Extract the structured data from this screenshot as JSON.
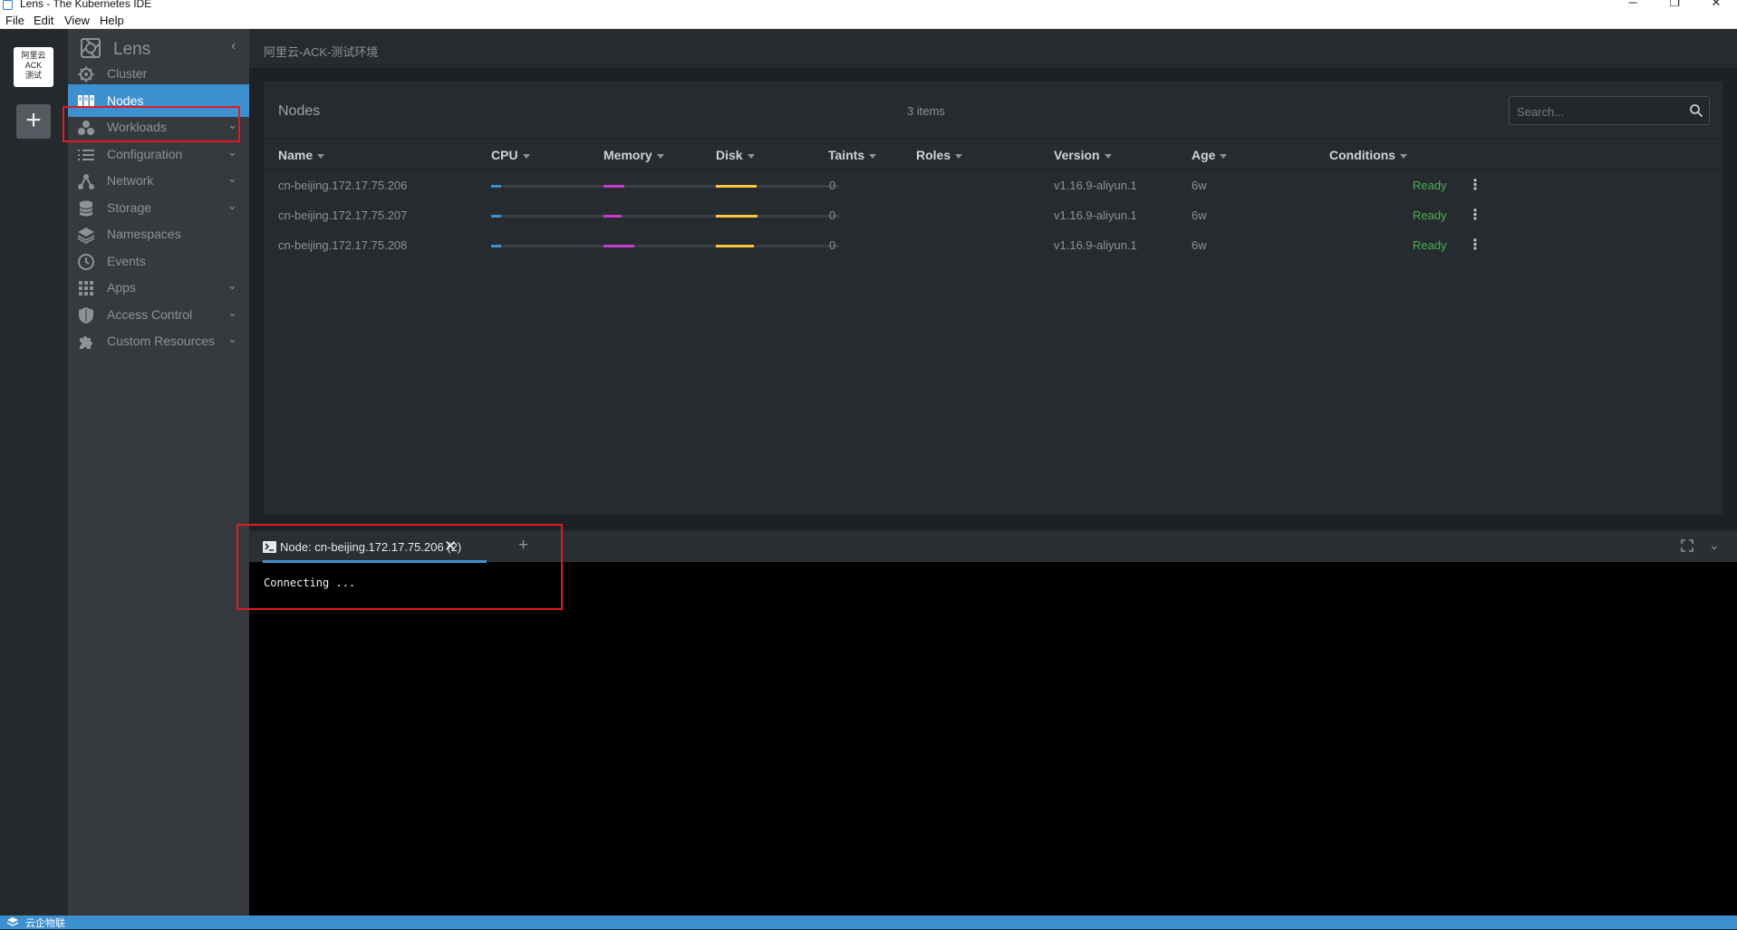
{
  "window": {
    "title": "Lens - The Kubernetes IDE",
    "controls": [
      "─",
      "❐",
      "✕"
    ]
  },
  "menu": [
    "File",
    "Edit",
    "View",
    "Help"
  ],
  "hotbar": {
    "cluster_label_lines": [
      "阿里云",
      "ACK",
      "测试"
    ],
    "add_label": "+"
  },
  "sidebar": {
    "brand": "Lens",
    "items": [
      {
        "label": "Cluster",
        "icon": "helm-wheel-icon",
        "expandable": false
      },
      {
        "label": "Nodes",
        "icon": "nodes-icon",
        "expandable": false,
        "active": true
      },
      {
        "label": "Workloads",
        "icon": "workloads-icon",
        "expandable": true
      },
      {
        "label": "Configuration",
        "icon": "list-icon",
        "expandable": true
      },
      {
        "label": "Network",
        "icon": "network-icon",
        "expandable": true
      },
      {
        "label": "Storage",
        "icon": "database-icon",
        "expandable": true
      },
      {
        "label": "Namespaces",
        "icon": "layers-icon",
        "expandable": false
      },
      {
        "label": "Events",
        "icon": "clock-icon",
        "expandable": false
      },
      {
        "label": "Apps",
        "icon": "apps-grid-icon",
        "expandable": true
      },
      {
        "label": "Access Control",
        "icon": "shield-icon",
        "expandable": true
      },
      {
        "label": "Custom Resources",
        "icon": "puzzle-icon",
        "expandable": true
      }
    ]
  },
  "breadcrumb": "阿里云-ACK-测试环境",
  "nodes": {
    "title": "Nodes",
    "count": "3 items",
    "search_placeholder": "Search...",
    "columns": [
      "Name",
      "CPU",
      "Memory",
      "Disk",
      "Taints",
      "Roles",
      "Version",
      "Age",
      "Conditions"
    ],
    "colors": {
      "cpu": "#3d90ce",
      "memory": "#c93dce",
      "disk": "#ffc63d",
      "ready": "#4caf50"
    },
    "rows": [
      {
        "name": "cn-beijing.172.17.75.206",
        "cpu": 0.08,
        "memory": 0.17,
        "disk": 0.33,
        "taints": "0",
        "roles": "",
        "version": "v1.16.9-aliyun.1",
        "age": "6w",
        "condition": "Ready"
      },
      {
        "name": "cn-beijing.172.17.75.207",
        "cpu": 0.08,
        "memory": 0.15,
        "disk": 0.34,
        "taints": "0",
        "roles": "",
        "version": "v1.16.9-aliyun.1",
        "age": "6w",
        "condition": "Ready"
      },
      {
        "name": "cn-beijing.172.17.75.208",
        "cpu": 0.08,
        "memory": 0.25,
        "disk": 0.31,
        "taints": "0",
        "roles": "",
        "version": "v1.16.9-aliyun.1",
        "age": "6w",
        "condition": "Ready"
      }
    ]
  },
  "dock": {
    "tab_label": "Node: cn-beijing.172.17.75.206 (2)",
    "terminal_text": "Connecting ..."
  },
  "statusbar": {
    "text": "云企物联"
  }
}
